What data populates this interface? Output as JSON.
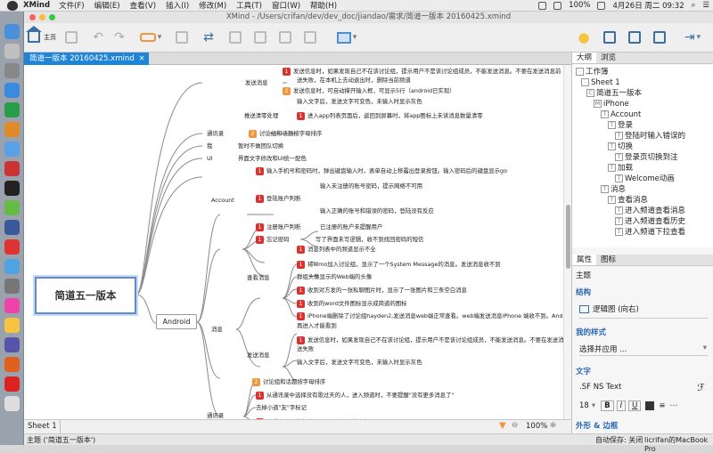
{
  "menubar": {
    "app": "XMind",
    "menus": [
      "文件(F)",
      "编辑(E)",
      "查看(V)",
      "插入(I)",
      "修改(M)",
      "工具(T)",
      "窗口(W)",
      "帮助(H)"
    ],
    "battery": "100%",
    "datetime": "4月26日 周二  09:32"
  },
  "window": {
    "title": "XMind - /Users/crifan/dev/dev_doc/jiandao/需求/简道一版本 20160425.xmind"
  },
  "toolbar": {
    "home_label": "主页"
  },
  "editor_tab": {
    "label": "简道一版本 20160425.xmind"
  },
  "mindmap": {
    "central": "简道五一版本",
    "android": "Android",
    "nodes": [
      {
        "text": "发送消息",
        "num": ""
      },
      {
        "text": "发送信息时，如果发现自己不在该讨论组，提示用户不是该讨论组成员，不能发送消息。不要在发送消息前",
        "num": "1"
      },
      {
        "text": "送失败，在本机上去动退出时，删除当前频道",
        "num": ""
      },
      {
        "text": "发送信息时，可自动撑开输入框，可显示5行（android已实现）",
        "num": "2"
      },
      {
        "text": "输入文字后，发送文字可变色，未输入时显示灰色",
        "num": ""
      },
      {
        "text": "推送清零处理",
        "num": ""
      },
      {
        "text": "进入app列表页面后，返回到屏幕时，将app图标上未读消息数量清零",
        "num": "1"
      },
      {
        "text": "通讯录",
        "num": ""
      },
      {
        "text": "讨论组和话题按字母排序",
        "num": "2"
      },
      {
        "text": "我",
        "num": ""
      },
      {
        "text": "暂时不做团队切换",
        "num": ""
      },
      {
        "text": "UI",
        "num": ""
      },
      {
        "text": "界面文字修改和UI统一配色",
        "num": ""
      },
      {
        "text": "输入手机号和密码时，弹出键盘输入时，表单自动上移露出登录按钮。输入密码后的键盘显示go",
        "num": "1"
      },
      {
        "text": "Account",
        "num": ""
      },
      {
        "text": "输入未注册的账号密码，提示网络不可用",
        "num": ""
      },
      {
        "text": "登陆账户判断",
        "num": "1"
      },
      {
        "text": "输入正确的账号和错误的密码，登陆没有反应",
        "num": ""
      },
      {
        "text": "注册账户判断",
        "num": "1"
      },
      {
        "text": "已注册的账户未提醒用户",
        "num": ""
      },
      {
        "text": "忘记密码",
        "num": "1"
      },
      {
        "text": "写了界面未写逻辑，收不到找回密码的短信",
        "num": ""
      },
      {
        "text": "消息列表中的频道显示不全",
        "num": "1"
      },
      {
        "text": "将lemo加入讨论组，显示了一个System Message的消息。发送消息收不到",
        "num": "1"
      },
      {
        "text": "查看消息",
        "num": ""
      },
      {
        "text": "群组头像显示的Web端的头像",
        "num": ""
      },
      {
        "text": "收到对方发的一张私聊图片时，显示了一张图片和三条空白消息",
        "num": "1"
      },
      {
        "text": "收到的word文件图标显示成简道的图标",
        "num": "1"
      },
      {
        "text": "消息",
        "num": ""
      },
      {
        "text": "iPhone端删除了讨论组hayden2,发送消息web端正常查看。web端发送消息iPhone 端收不到。Android端",
        "num": "1"
      },
      {
        "text": "再进入才能看到",
        "num": ""
      },
      {
        "text": "发送消息",
        "num": ""
      },
      {
        "text": "发送信息时，如果发现自己不在该讨论组，提示用户不是该讨论组成员，不能发送消息。不要在发送消息前",
        "num": "1"
      },
      {
        "text": "送失败",
        "num": ""
      },
      {
        "text": "输入文字后，发送文字可变色，未输入时显示灰色",
        "num": ""
      },
      {
        "text": "讨论组和话题按字母排序",
        "num": "2"
      },
      {
        "text": "从通讯录中选择没有歌过天的人，进入频道时，不要提醒\"没有更多消息了\"",
        "num": "1"
      },
      {
        "text": "通讯录",
        "num": ""
      },
      {
        "text": "去掉小道\"友\"字标记",
        "num": ""
      },
      {
        "text": "联系人字母检索时，不要显示红色的底色",
        "num": "1"
      }
    ]
  },
  "sheet": {
    "name": "Sheet 1",
    "zoom": "100%"
  },
  "outline": {
    "tabs": [
      "大纲",
      "浏览"
    ],
    "items": [
      {
        "text": "工作簿",
        "icon": "-"
      },
      {
        "text": "Sheet 1",
        "icon": "-"
      },
      {
        "text": "简道五一版本",
        "icon": "C"
      },
      {
        "text": "iPhone",
        "icon": "M"
      },
      {
        "text": "Account",
        "icon": "T"
      },
      {
        "text": "登录",
        "icon": "T"
      },
      {
        "text": "登陆时输入错误的",
        "icon": "T"
      },
      {
        "text": "切换",
        "icon": "T"
      },
      {
        "text": "登录页切换到注",
        "icon": "T"
      },
      {
        "text": "加载",
        "icon": "T"
      },
      {
        "text": "Welcome动画",
        "icon": "T"
      },
      {
        "text": "消息",
        "icon": "T"
      },
      {
        "text": "查看消息",
        "icon": "T"
      },
      {
        "text": "进入频道查看消息",
        "icon": "T"
      },
      {
        "text": "进入频道查看历史",
        "icon": "T"
      },
      {
        "text": "进入频道下拉查看",
        "icon": "T"
      }
    ]
  },
  "properties": {
    "tabs": [
      "属性",
      "图标"
    ],
    "subject": "主题",
    "structure_heading": "结构",
    "structure_value": "逻辑图 (向右)",
    "style_heading": "我的样式",
    "style_value": "选择并应用 ...",
    "text_heading": "文字",
    "font_value": ".SF NS Text",
    "font_size": "18",
    "bold": "B",
    "italic": "I",
    "underline": "U",
    "border_heading": "外形 & 边框"
  },
  "statusbar": {
    "left": "主题 ('简道五一版本')",
    "autosave": "自动保存: 关闭",
    "machine": "licrifan的MacBook Pro"
  },
  "colors": {
    "tab_blue": "#1d84d8",
    "num1_red": "#d9322f",
    "num2_orange": "#f0953a",
    "main_border": "#5b8bd0"
  }
}
